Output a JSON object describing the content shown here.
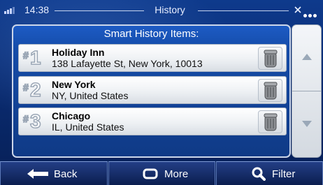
{
  "status": {
    "time": "14:38",
    "title": "History"
  },
  "panel": {
    "header": "Smart History Items:"
  },
  "items": [
    {
      "rank": "1",
      "name": "Holiday Inn",
      "address": "138 Lafayette St, New York, 10013"
    },
    {
      "rank": "2",
      "name": "New York",
      "address": "NY, United States"
    },
    {
      "rank": "3",
      "name": "Chicago",
      "address": "IL, United States"
    }
  ],
  "bottom": {
    "back_label": "Back",
    "more_label": "More",
    "filter_label": "Filter"
  },
  "icons": {
    "row_delete": "trash-icon",
    "scroll_up": "triangle-up-icon",
    "scroll_down": "triangle-down-icon",
    "back": "arrow-left-icon",
    "more": "rounded-square-icon",
    "filter": "magnifier-icon"
  }
}
